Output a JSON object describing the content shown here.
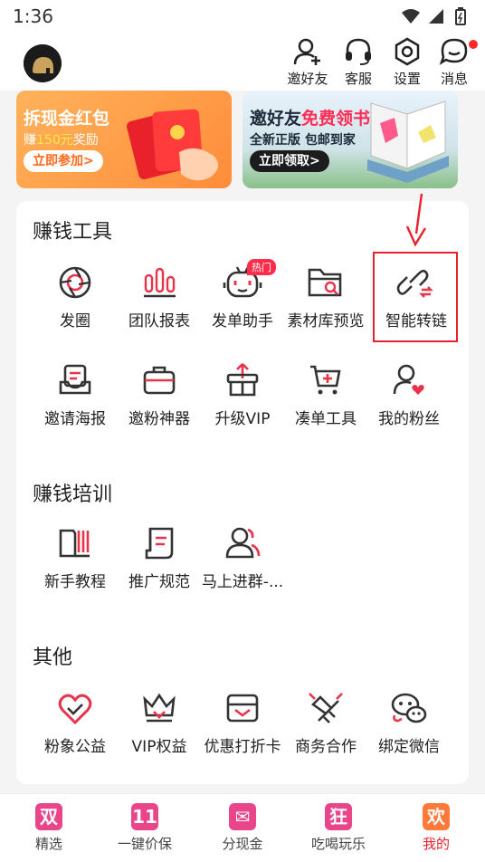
{
  "status": {
    "time": "1:36"
  },
  "header": {
    "actions": [
      {
        "label": "邀好友",
        "icon": "add-friend-icon"
      },
      {
        "label": "客服",
        "icon": "headset-icon"
      },
      {
        "label": "设置",
        "icon": "settings-hex-icon"
      },
      {
        "label": "消息",
        "icon": "message-icon"
      }
    ]
  },
  "banners": {
    "left": {
      "title": "拆现金红包",
      "sub_prefix": "赚",
      "sub_highlight": "150元",
      "sub_suffix": "奖励",
      "cta": "立即参加>"
    },
    "right": {
      "title_prefix": "邀好友",
      "title_highlight": "免费领书",
      "sub": "全新正版 包邮到家",
      "cta": "立即领取>"
    }
  },
  "sections": {
    "earn_tools": {
      "title": "赚钱工具",
      "items": [
        {
          "label": "发圈"
        },
        {
          "label": "团队报表"
        },
        {
          "label": "发单助手",
          "badge": "热门"
        },
        {
          "label": "素材库预览"
        },
        {
          "label": "智能转链"
        },
        {
          "label": "邀请海报"
        },
        {
          "label": "邀粉神器"
        },
        {
          "label": "升级VIP"
        },
        {
          "label": "凑单工具"
        },
        {
          "label": "我的粉丝"
        }
      ]
    },
    "training": {
      "title": "赚钱培训",
      "items": [
        {
          "label": "新手教程"
        },
        {
          "label": "推广规范"
        },
        {
          "label": "马上进群-..."
        }
      ]
    },
    "other": {
      "title": "其他",
      "items": [
        {
          "label": "粉象公益"
        },
        {
          "label": "VIP权益"
        },
        {
          "label": "优惠打折卡"
        },
        {
          "label": "商务合作"
        },
        {
          "label": "绑定微信"
        }
      ]
    }
  },
  "tabbar": {
    "tabs": [
      {
        "label": "精选",
        "glyph": "双",
        "color": "#e8458a"
      },
      {
        "label": "一键价保",
        "glyph": "11",
        "color": "#e8458a"
      },
      {
        "label": "分现金",
        "glyph": "✉",
        "color": "#e8458a"
      },
      {
        "label": "吃喝玩乐",
        "glyph": "狂",
        "color": "#e8458a"
      },
      {
        "label": "我的",
        "glyph": "欢",
        "color": "#ff7a3a",
        "active": true
      }
    ]
  },
  "colors": {
    "accent": "#e8212b",
    "icon_red": "#e8344a",
    "icon_dark": "#333333"
  }
}
